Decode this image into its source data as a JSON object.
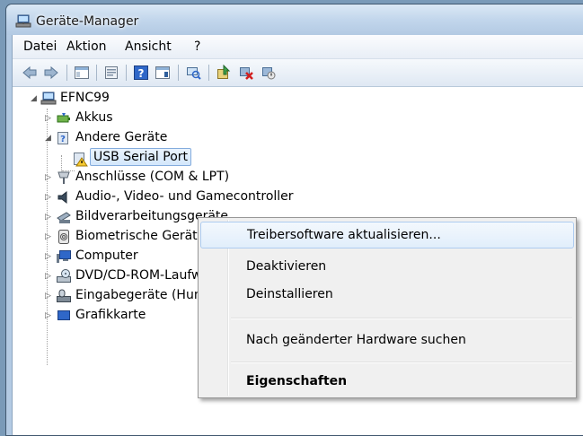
{
  "window": {
    "title": "Geräte-Manager"
  },
  "menu": [
    "Datei",
    "Aktion",
    "Ansicht",
    "?"
  ],
  "toolbar": {
    "buttons": [
      "back-arrow-icon",
      "forward-arrow-icon",
      "show-hide-console-tree-icon",
      "properties-icon",
      "help-icon",
      "action-pane-icon",
      "scan-hardware-icon",
      "update-driver-icon",
      "uninstall-icon",
      "disable-icon"
    ]
  },
  "tree": {
    "root": "EFNC99",
    "items": [
      {
        "label": "Akkus"
      },
      {
        "label": "Andere Geräte"
      },
      {
        "label": "USB Serial Port"
      },
      {
        "label": "Anschlüsse (COM & LPT)"
      },
      {
        "label": "Audio-, Video- und Gamecontroller"
      },
      {
        "label": "Bildverarbeitungsgeräte"
      },
      {
        "label": "Biometrische Geräte"
      },
      {
        "label": "Computer"
      },
      {
        "label": "DVD/CD-ROM-Laufwerke"
      },
      {
        "label": "Eingabegeräte (Human Interface Devices)"
      },
      {
        "label": "Grafikkarte"
      }
    ]
  },
  "context_menu": {
    "items": [
      {
        "label": "Treibersoftware aktualisieren..."
      },
      {
        "label": "Deaktivieren"
      },
      {
        "label": "Deinstallieren"
      },
      {
        "label": "Nach geänderter Hardware suchen"
      },
      {
        "label": "Eigenschaften"
      }
    ]
  }
}
